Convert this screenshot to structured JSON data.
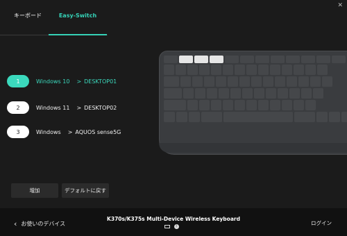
{
  "window": {
    "close": "✕"
  },
  "tabs": [
    {
      "label": "キーボード"
    },
    {
      "label": "Easy-Switch"
    }
  ],
  "channels": [
    {
      "number": "1",
      "os": "Windows 10",
      "arrow": ">",
      "device": "DESKTOP01",
      "active": true
    },
    {
      "number": "2",
      "os": "Windows 11",
      "arrow": ">",
      "device": "DESKTOP02",
      "active": false
    },
    {
      "number": "3",
      "os": "Windows",
      "arrow": ">",
      "device": "AQUOS sense5G",
      "active": false
    }
  ],
  "buttons": {
    "add": "増加",
    "default": "デフォルトに戻す"
  },
  "footer": {
    "back_label": "お使いのデバイス",
    "device_name": "K370s/K375s Multi-Device Wireless Keyboard",
    "login": "ログイン"
  },
  "colors": {
    "accent": "#35d2b7",
    "background": "#1b1b1b",
    "footer": "#111111"
  },
  "icons": {
    "back": "chevron-left-icon",
    "battery": "battery-icon",
    "bluetooth": "bluetooth-icon"
  }
}
